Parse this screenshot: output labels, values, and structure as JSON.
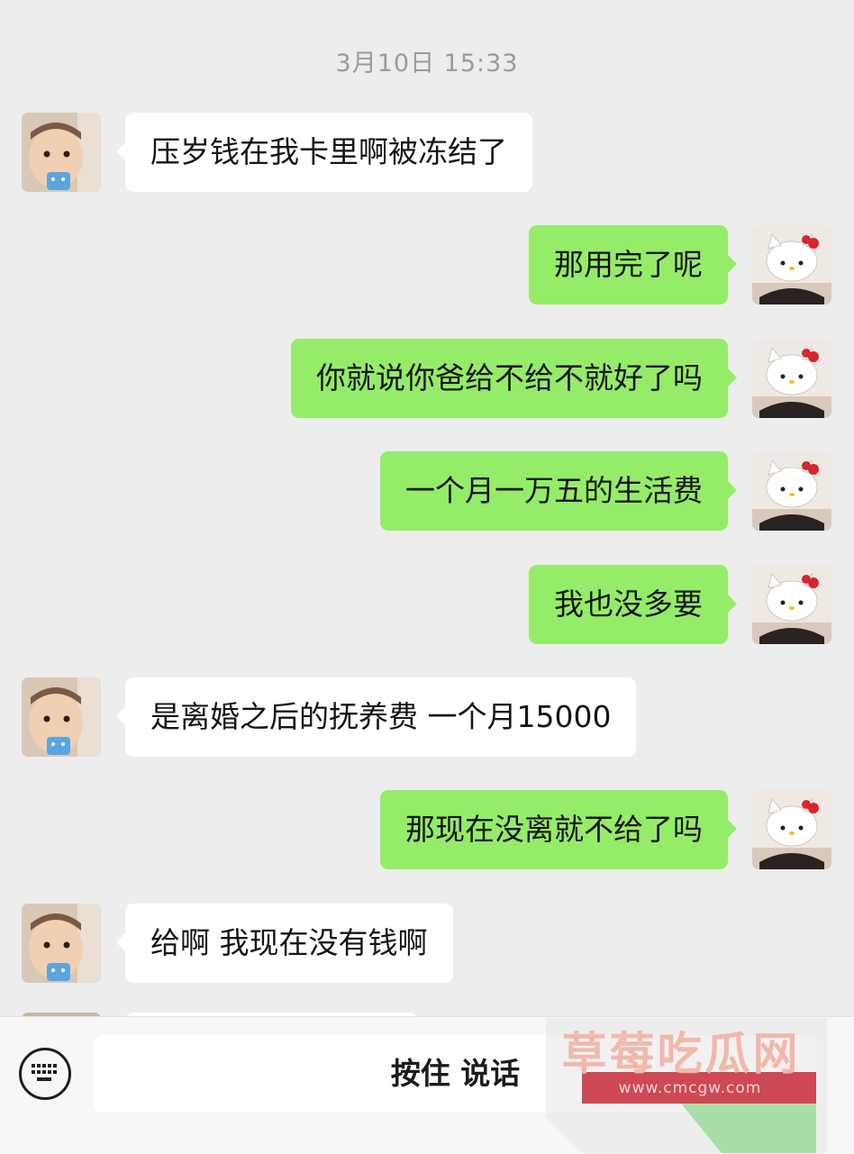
{
  "chat": {
    "timestamp": "3月10日 15:33",
    "messages": [
      {
        "side": "in",
        "text": "压岁钱在我卡里啊被冻结了"
      },
      {
        "side": "out",
        "text": "那用完了呢"
      },
      {
        "side": "out",
        "text": "你就说你爸给不给不就好了吗"
      },
      {
        "side": "out",
        "text": "一个月一万五的生活费"
      },
      {
        "side": "out",
        "text": "我也没多要"
      },
      {
        "side": "in",
        "text": "是离婚之后的抚养费 一个月15000"
      },
      {
        "side": "out",
        "text": "那现在没离就不给了吗"
      },
      {
        "side": "in",
        "text": "给啊 我现在没有钱啊"
      }
    ]
  },
  "avatars": {
    "left": "baby-photo-avatar",
    "right": "hello-kitty-hat-avatar"
  },
  "input_bar": {
    "keyboard_icon": "keyboard-icon",
    "hold_to_talk_label": "按住 说话"
  },
  "watermark": {
    "title": "草莓吃瓜网",
    "url": "www.cmcgw.com"
  },
  "colors": {
    "background": "#ededed",
    "incoming_bubble": "#ffffff",
    "outgoing_bubble": "#95ec69",
    "timestamp_text": "#9a9a9a"
  }
}
